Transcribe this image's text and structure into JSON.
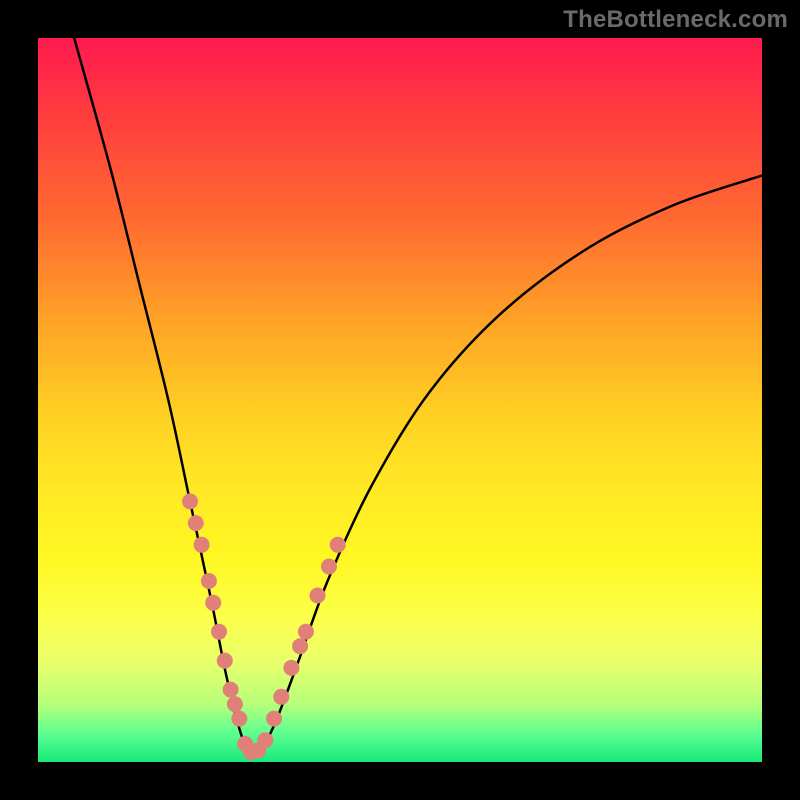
{
  "watermark": "TheBottleneck.com",
  "colors": {
    "bead": "#e08078",
    "curve": "#000000",
    "frame": "#000000"
  },
  "chart_data": {
    "type": "line",
    "title": "",
    "xlabel": "",
    "ylabel": "",
    "xlim": [
      0,
      100
    ],
    "ylim": [
      0,
      100
    ],
    "grid": false,
    "legend": false,
    "description": "Bottleneck-style V curve over a vertical rainbow gradient (red at top → green at bottom). The curve drops steeply from top-left, bottoms out around x≈28–31 near y≈0, then rises with decreasing slope toward the upper right. Small salmon-colored beads sit on the lower portions of both arms.",
    "series": [
      {
        "name": "bottleneck-curve",
        "x": [
          5,
          10,
          14,
          18,
          21,
          24,
          26,
          28,
          29.5,
          31,
          33,
          36,
          40,
          46,
          54,
          64,
          76,
          88,
          100
        ],
        "y": [
          100,
          82,
          66,
          50,
          36,
          22,
          12,
          4,
          1,
          2,
          6,
          14,
          25,
          38,
          51,
          62,
          71,
          77,
          81
        ]
      }
    ],
    "markers": {
      "name": "curve-beads",
      "radius": 8,
      "points_left_arm": [
        {
          "x": 21.0,
          "y": 36
        },
        {
          "x": 21.8,
          "y": 33
        },
        {
          "x": 22.6,
          "y": 30
        },
        {
          "x": 23.6,
          "y": 25
        },
        {
          "x": 24.2,
          "y": 22
        },
        {
          "x": 25.0,
          "y": 18
        },
        {
          "x": 25.8,
          "y": 14
        },
        {
          "x": 26.6,
          "y": 10
        },
        {
          "x": 27.2,
          "y": 8
        },
        {
          "x": 27.8,
          "y": 6
        }
      ],
      "points_bottom": [
        {
          "x": 28.6,
          "y": 2.5
        },
        {
          "x": 29.4,
          "y": 1.4
        },
        {
          "x": 30.4,
          "y": 1.6
        },
        {
          "x": 31.4,
          "y": 3.0
        }
      ],
      "points_right_arm": [
        {
          "x": 32.6,
          "y": 6
        },
        {
          "x": 33.6,
          "y": 9
        },
        {
          "x": 35.0,
          "y": 13
        },
        {
          "x": 36.2,
          "y": 16
        },
        {
          "x": 37.0,
          "y": 18
        },
        {
          "x": 38.6,
          "y": 23
        },
        {
          "x": 40.2,
          "y": 27
        },
        {
          "x": 41.4,
          "y": 30
        }
      ]
    }
  }
}
